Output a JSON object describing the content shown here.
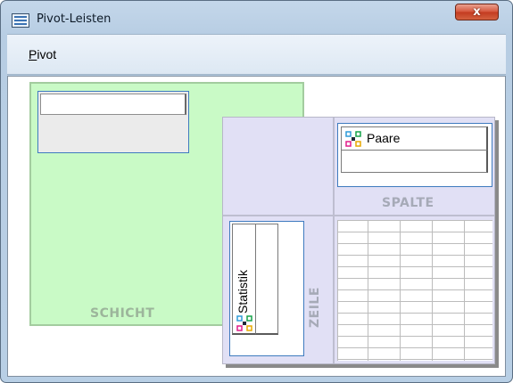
{
  "window": {
    "title": "Pivot-Leisten",
    "close_glyph": "x",
    "icon": "pivot-table-app-icon"
  },
  "menu": {
    "items": [
      {
        "label_underlined": "P",
        "label_rest": "ivot"
      }
    ]
  },
  "layers": {
    "label": "SCHICHT",
    "color": "#c9fac6"
  },
  "columns": {
    "label": "SPALTE",
    "items": [
      {
        "label": "Paare",
        "icon": "pivot-dimension-icon"
      }
    ]
  },
  "rows": {
    "label": "ZEILE",
    "items": [
      {
        "label": "Statistik",
        "icon": "pivot-dimension-icon"
      }
    ]
  },
  "colors": {
    "accent_border": "#3f7bbf",
    "pivot_panel": "#e1e0f5",
    "close_button": "#c23a20"
  }
}
